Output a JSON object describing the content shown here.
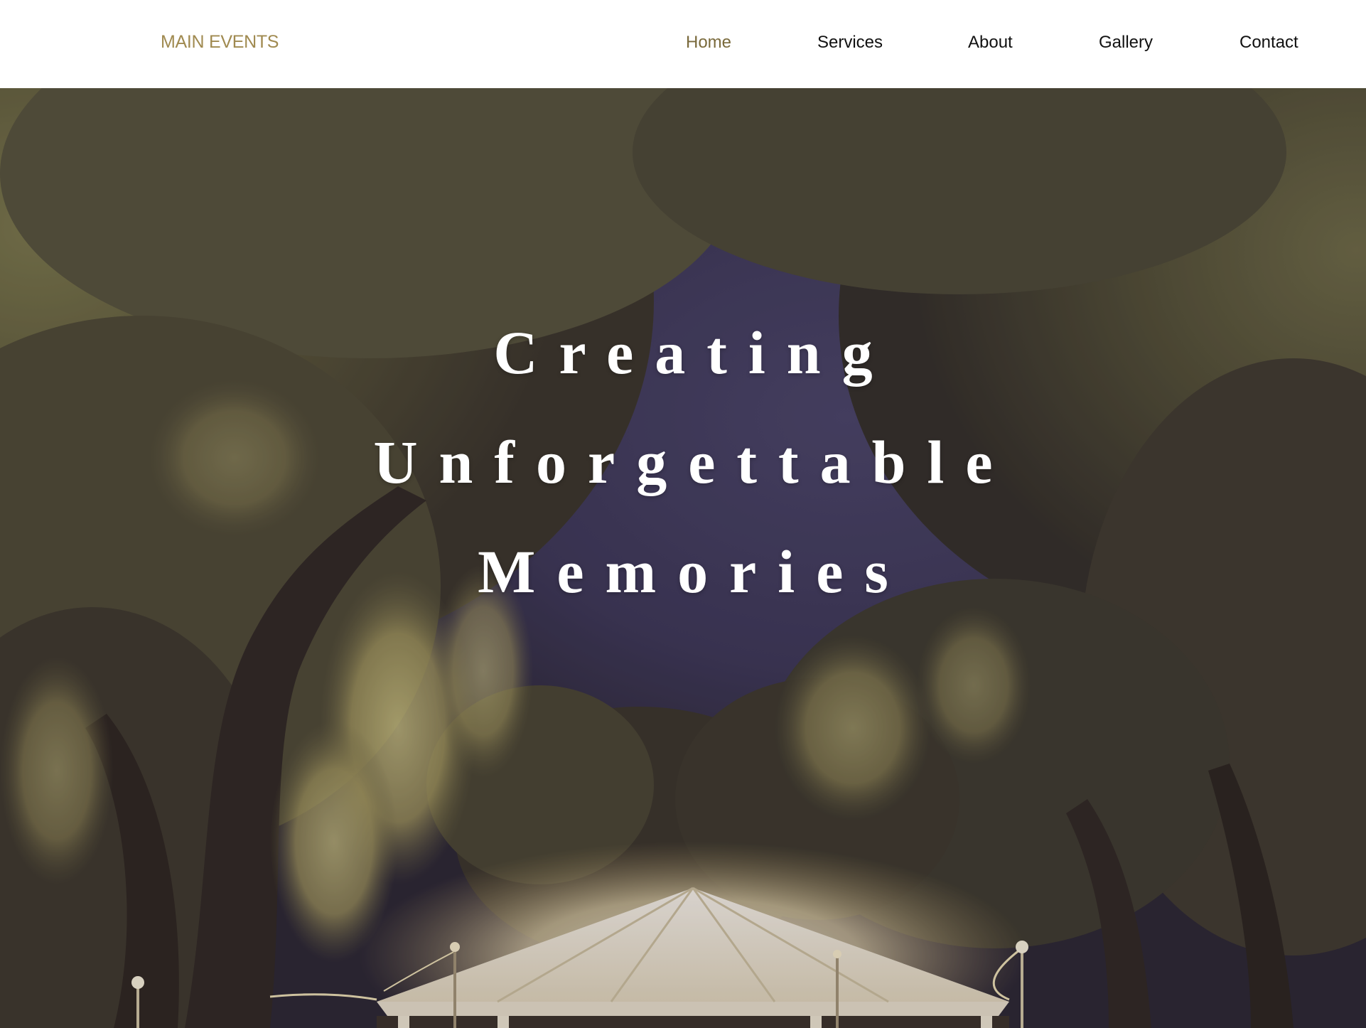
{
  "brand": {
    "name": "MAIN EVENTS",
    "color": "#a08a50"
  },
  "nav": {
    "items": [
      {
        "label": "Home",
        "active": true
      },
      {
        "label": "Services",
        "active": false
      },
      {
        "label": "About",
        "active": false
      },
      {
        "label": "Gallery",
        "active": false
      },
      {
        "label": "Contact",
        "active": false
      }
    ]
  },
  "hero": {
    "headline": [
      "Creating",
      "Unforgettable",
      "Memories"
    ],
    "image": "night-oak-trees-with-lit-tent"
  }
}
